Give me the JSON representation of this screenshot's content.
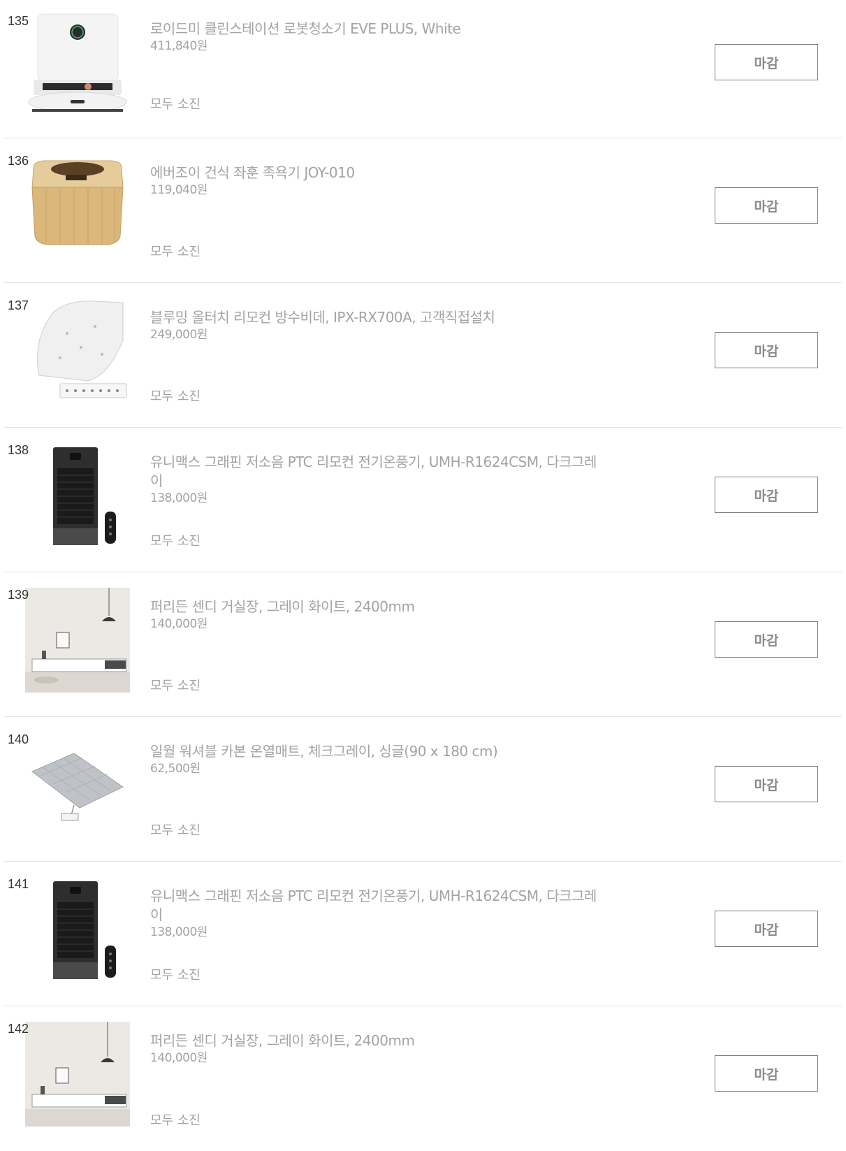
{
  "products": [
    {
      "number": "135",
      "name": "로이드미 클린스테이션 로봇청소기 EVE PLUS, White",
      "price": "411,840원",
      "status": "모두 소진",
      "button": "마감",
      "image": "robot-vacuum-image"
    },
    {
      "number": "136",
      "name": "에버조이 건식 좌훈 족욕기 JOY-010",
      "price": "119,040원",
      "status": "모두 소진",
      "button": "마감",
      "image": "foot-bath-image"
    },
    {
      "number": "137",
      "name": "블루밍 올터치 리모컨 방수비데, IPX-RX700A, 고객직접설치",
      "price": "249,000원",
      "status": "모두 소진",
      "button": "마감",
      "image": "bidet-image"
    },
    {
      "number": "138",
      "name": "유니맥스 그래핀 저소음 PTC 리모컨 전기온풍기, UMH-R1624CSM, 다크그레이",
      "price": "138,000원",
      "status": "모두 소진",
      "button": "마감",
      "image": "heater-image"
    },
    {
      "number": "139",
      "name": "퍼리든 센디 거실장, 그레이 화이트, 2400mm",
      "price": "140,000원",
      "status": "모두 소진",
      "button": "마감",
      "image": "tv-cabinet-image"
    },
    {
      "number": "140",
      "name": "일월 워셔블 카본 온열매트, 체크그레이, 싱글(90 x 180 cm)",
      "price": "62,500원",
      "status": "모두 소진",
      "button": "마감",
      "image": "heating-mat-image"
    },
    {
      "number": "141",
      "name": "유니맥스 그래핀 저소음 PTC 리모컨 전기온풍기, UMH-R1624CSM, 다크그레이",
      "price": "138,000원",
      "status": "모두 소진",
      "button": "마감",
      "image": "heater-image"
    },
    {
      "number": "142",
      "name": "퍼리든 센디 거실장, 그레이 화이트, 2400mm",
      "price": "140,000원",
      "status": "모두 소진",
      "button": "마감",
      "image": "tv-cabinet-image"
    }
  ]
}
